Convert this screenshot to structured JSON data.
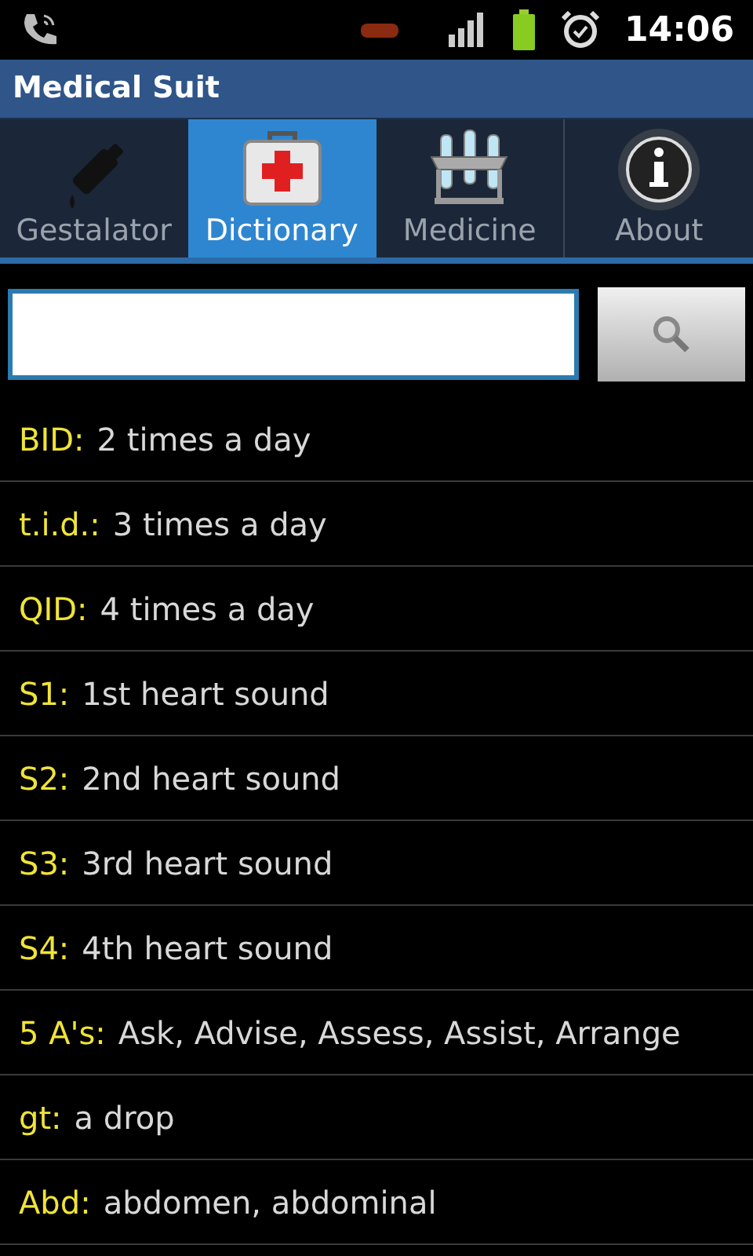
{
  "status_bar": {
    "time": "14:06"
  },
  "window": {
    "title": "Medical Suit"
  },
  "tabs": [
    {
      "label": "Gestalator",
      "kind": "bottle",
      "selected": false
    },
    {
      "label": "Dictionary",
      "kind": "kit",
      "selected": true
    },
    {
      "label": "Medicine",
      "kind": "rack",
      "selected": false
    },
    {
      "label": "About",
      "kind": "info",
      "selected": false
    }
  ],
  "entries": [
    {
      "term": "BID:",
      "meaning": "2 times a day"
    },
    {
      "term": "t.i.d.:",
      "meaning": "3 times a day"
    },
    {
      "term": "QID:",
      "meaning": "4 times a day"
    },
    {
      "term": "S1:",
      "meaning": "1st heart sound"
    },
    {
      "term": "S2:",
      "meaning": "2nd heart sound"
    },
    {
      "term": "S3:",
      "meaning": "3rd heart sound"
    },
    {
      "term": "S4:",
      "meaning": "4th heart sound"
    },
    {
      "term": "5 A's:",
      "meaning": "Ask, Advise, Assess, Assist, Arrange"
    },
    {
      "term": "gt:",
      "meaning": "a drop"
    },
    {
      "term": "Abd:",
      "meaning": "abdomen, abdominal"
    }
  ]
}
